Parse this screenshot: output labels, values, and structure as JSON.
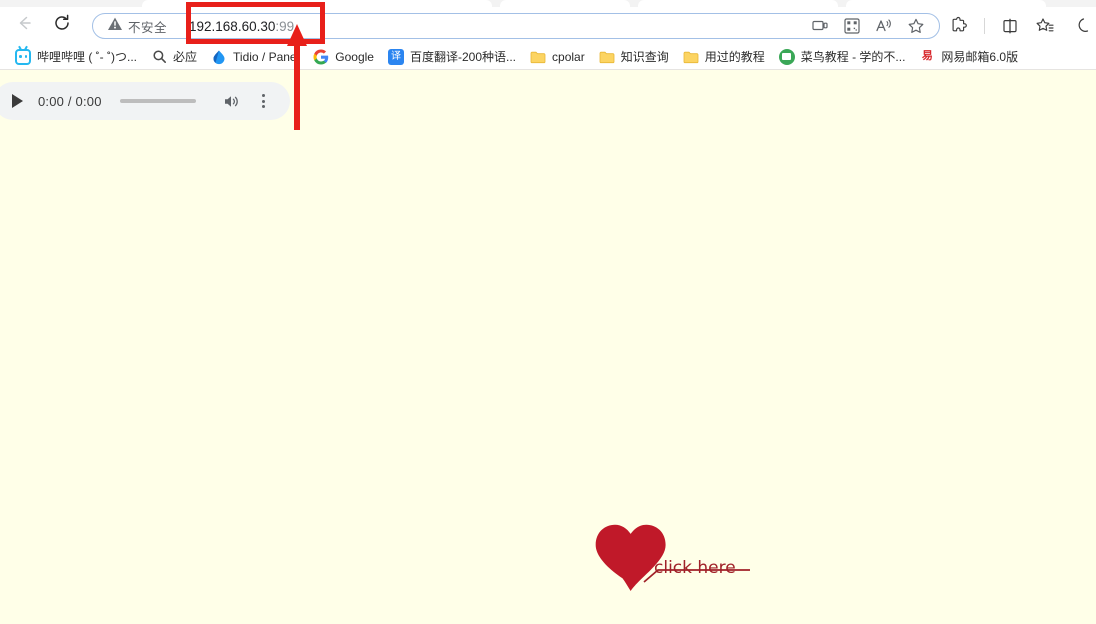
{
  "browser": {
    "nav": {
      "back_icon": "back-arrow-icon",
      "reload_icon": "reload-icon"
    },
    "address_bar": {
      "security_label": "不安全",
      "security_icon": "warning-triangle-icon",
      "url_host": "192.168.60.30",
      "url_port": ":99",
      "full_url": "192.168.60.30:99",
      "trailing_icons": [
        "cast-icon",
        "qr-code-icon",
        "read-aloud-icon",
        "favorite-star-icon"
      ]
    },
    "right_toolbar": [
      "extensions-puzzle-icon",
      "split-screen-icon",
      "collections-icon",
      "browser-essentials-icon"
    ],
    "bookmarks": [
      {
        "label": "哔哩哔哩 ( ˚- ˚)つ...",
        "icon": "bilibili-icon"
      },
      {
        "label": "必应",
        "icon": "bing-search-icon"
      },
      {
        "label": "Tidio / Panel",
        "icon": "tidio-icon"
      },
      {
        "label": "Google",
        "icon": "google-icon"
      },
      {
        "label": "百度翻译-200种语...",
        "icon": "baidu-translate-icon"
      },
      {
        "label": "cpolar",
        "icon": "folder-icon"
      },
      {
        "label": "知识查询",
        "icon": "folder-icon"
      },
      {
        "label": "用过的教程",
        "icon": "folder-icon"
      },
      {
        "label": "菜鸟教程 - 学的不...",
        "icon": "runoob-icon"
      },
      {
        "label": "网易邮箱6.0版",
        "icon": "netease-mail-icon"
      }
    ]
  },
  "page": {
    "background_color": "#ffffe8",
    "audio_player": {
      "play_icon": "play-triangle-icon",
      "time_display": "0:00 / 0:00",
      "volume_icon": "volume-icon",
      "menu_icon": "more-vertical-icon"
    },
    "heart": {
      "shape_name": "heart-shape",
      "color": "#c01929"
    },
    "link": {
      "text": "click here",
      "color": "#a02128"
    }
  },
  "annotations": {
    "highlight_box": {
      "name": "url-highlight-box",
      "color": "#e8201a",
      "target": "192.168.60.30:99"
    },
    "arrow": {
      "name": "pointer-arrow",
      "color": "#e8201a",
      "direction": "up"
    }
  }
}
